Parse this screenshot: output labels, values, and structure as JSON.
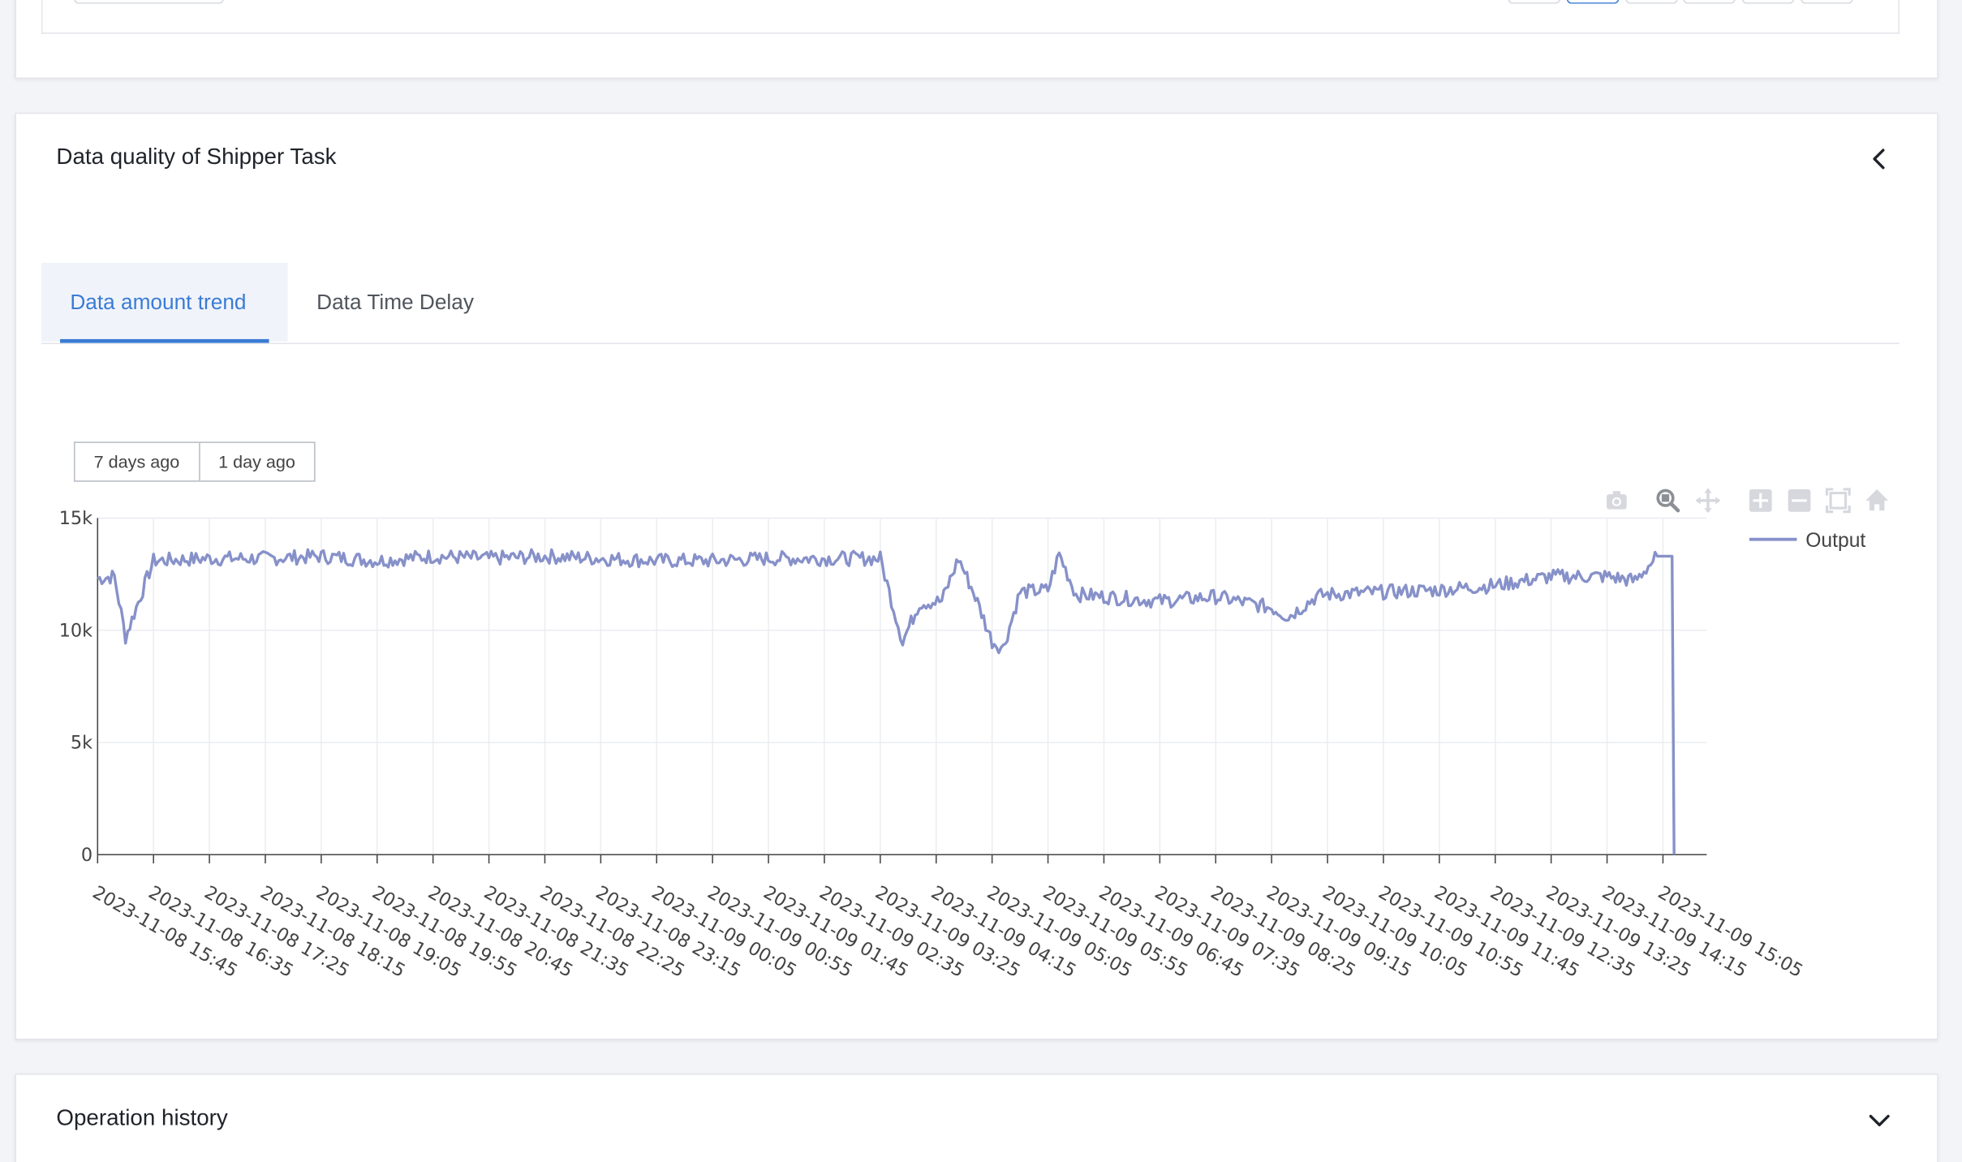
{
  "quality_section": {
    "title": "Data quality of Shipper Task",
    "tabs": [
      {
        "label": "Data amount trend",
        "active": true
      },
      {
        "label": "Data Time Delay",
        "active": false
      }
    ],
    "range_buttons": [
      "7 days ago",
      "1 day ago"
    ],
    "modebar_icons": [
      "camera-icon",
      "zoom-icon",
      "pan-icon",
      "zoom-in-icon",
      "zoom-out-icon",
      "autoscale-icon",
      "reset-axes-icon"
    ]
  },
  "history_section": {
    "title": "Operation history"
  },
  "colors": {
    "accent": "#3a7bd5",
    "series": "#8791c9"
  },
  "chart_data": {
    "type": "line",
    "title": "",
    "xlabel": "",
    "ylabel": "",
    "ylim": [
      0,
      15000
    ],
    "yticks": [
      0,
      5000,
      10000,
      15000
    ],
    "ytick_labels": [
      "0",
      "5k",
      "10k",
      "15k"
    ],
    "xtick_labels": [
      "2023-11-08 15:45",
      "2023-11-08 16:35",
      "2023-11-08 17:25",
      "2023-11-08 18:15",
      "2023-11-08 19:05",
      "2023-11-08 19:55",
      "2023-11-08 20:45",
      "2023-11-08 21:35",
      "2023-11-08 22:25",
      "2023-11-08 23:15",
      "2023-11-09 00:05",
      "2023-11-09 00:55",
      "2023-11-09 01:45",
      "2023-11-09 02:35",
      "2023-11-09 03:25",
      "2023-11-09 04:15",
      "2023-11-09 05:05",
      "2023-11-09 05:55",
      "2023-11-09 06:45",
      "2023-11-09 07:35",
      "2023-11-09 08:25",
      "2023-11-09 09:15",
      "2023-11-09 10:05",
      "2023-11-09 10:55",
      "2023-11-09 11:45",
      "2023-11-09 12:35",
      "2023-11-09 13:25",
      "2023-11-09 14:15",
      "2023-11-09 15:05"
    ],
    "grid": true,
    "legend_position": "top-right",
    "series": [
      {
        "name": "Output",
        "x": [
          "2023-11-08 15:45",
          "2023-11-08 16:00",
          "2023-11-08 16:10",
          "2023-11-08 16:35",
          "2023-11-08 17:25",
          "2023-11-08 18:15",
          "2023-11-08 19:05",
          "2023-11-08 19:55",
          "2023-11-08 20:45",
          "2023-11-08 21:35",
          "2023-11-08 22:25",
          "2023-11-08 23:15",
          "2023-11-09 00:05",
          "2023-11-09 00:55",
          "2023-11-09 01:45",
          "2023-11-09 02:35",
          "2023-11-09 03:25",
          "2023-11-09 03:45",
          "2023-11-09 04:00",
          "2023-11-09 04:20",
          "2023-11-09 04:35",
          "2023-11-09 04:50",
          "2023-11-09 05:05",
          "2023-11-09 05:15",
          "2023-11-09 05:30",
          "2023-11-09 05:55",
          "2023-11-09 06:05",
          "2023-11-09 06:20",
          "2023-11-09 06:45",
          "2023-11-09 07:35",
          "2023-11-09 08:25",
          "2023-11-09 09:15",
          "2023-11-09 09:30",
          "2023-11-09 09:55",
          "2023-11-09 10:05",
          "2023-11-09 10:55",
          "2023-11-09 11:45",
          "2023-11-09 12:35",
          "2023-11-09 13:25",
          "2023-11-09 14:15",
          "2023-11-09 14:40",
          "2023-11-09 15:00",
          "2023-11-09 15:15"
        ],
        "y": [
          12300,
          12400,
          9700,
          13100,
          13200,
          13200,
          13300,
          13100,
          13300,
          13200,
          13300,
          13200,
          13100,
          13100,
          13200,
          13200,
          13200,
          9500,
          11200,
          11300,
          13200,
          11500,
          9500,
          9200,
          11700,
          11800,
          13400,
          11600,
          11500,
          11300,
          11500,
          11000,
          10600,
          11500,
          11600,
          11700,
          11800,
          12000,
          12400,
          12400,
          12200,
          13300,
          0
        ]
      }
    ]
  }
}
